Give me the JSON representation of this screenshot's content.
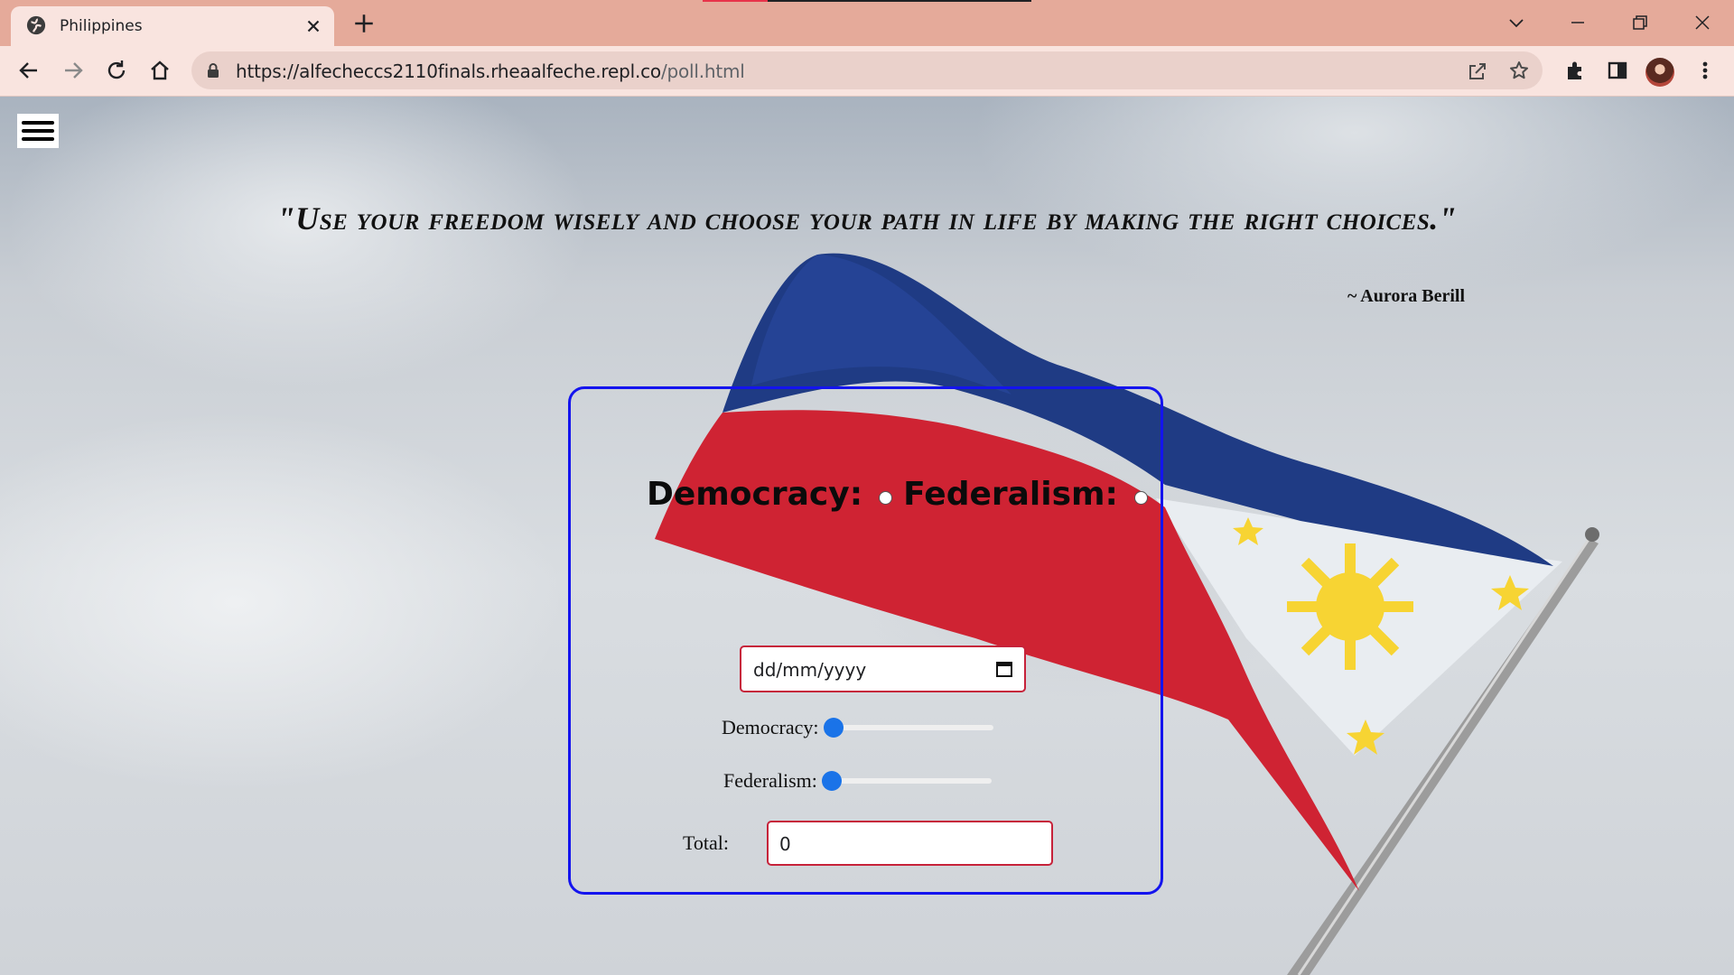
{
  "browser": {
    "tab_title": "Philippines",
    "url_main": "https://alfecheccs2110finals.rheaalfeche.repl.co",
    "url_path": "/poll.html"
  },
  "page": {
    "quote": "\"Use your freedom wisely and choose your path in life by making the right choices.\"",
    "author": "~ Aurora Berill",
    "poll": {
      "option1_label": "Democracy:",
      "option2_label": "Federalism:",
      "date_placeholder": "dd/mm/yyyy",
      "slider1_label": "Democracy:",
      "slider1_value": 0,
      "slider2_label": "Federalism:",
      "slider2_value": 0,
      "total_label": "Total:",
      "total_value": "0"
    }
  },
  "colors": {
    "card_border": "#1414ee",
    "input_border": "#c6223a",
    "slider_thumb": "#1a73e8",
    "tab_strip": "#e5aa9a"
  }
}
